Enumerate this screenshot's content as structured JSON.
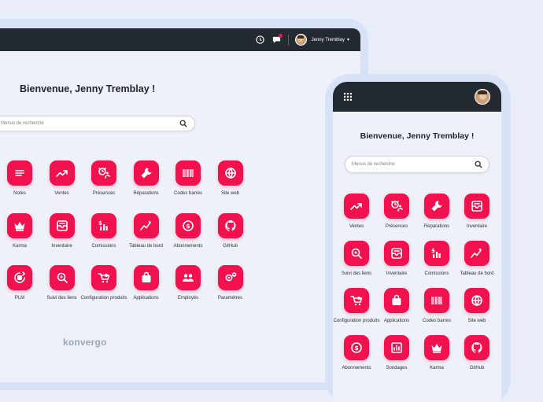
{
  "app": {
    "brand": "konvergo"
  },
  "desktop": {
    "user_name": "Jenny Tremblay",
    "welcome": "Bienvenue, Jenny Tremblay !",
    "search_placeholder": "Menus de recherche",
    "apps": [
      {
        "label": "Notes",
        "icon": "notes-icon"
      },
      {
        "label": "Ventes",
        "icon": "trend-up-icon"
      },
      {
        "label": "Présences",
        "icon": "attendance-icon"
      },
      {
        "label": "Réparations",
        "icon": "wrench-icon"
      },
      {
        "label": "Codes barres",
        "icon": "barcode-icon"
      },
      {
        "label": "Site web",
        "icon": "globe-icon"
      },
      {
        "label": "Karma",
        "icon": "crown-icon"
      },
      {
        "label": "Inventaire",
        "icon": "inventory-icon"
      },
      {
        "label": "Comissions",
        "icon": "commission-icon"
      },
      {
        "label": "Tableau de bord",
        "icon": "dashboard-icon"
      },
      {
        "label": "Abonnements",
        "icon": "subscription-icon"
      },
      {
        "label": "GitHub",
        "icon": "github-icon"
      },
      {
        "label": "PLM",
        "icon": "plm-icon"
      },
      {
        "label": "Suivi des liens",
        "icon": "link-tracker-icon"
      },
      {
        "label": "Configuration produits",
        "icon": "product-config-icon"
      },
      {
        "label": "Applications",
        "icon": "bag-icon"
      },
      {
        "label": "Employés",
        "icon": "employees-icon"
      },
      {
        "label": "Paramètres",
        "icon": "gear-icon"
      }
    ]
  },
  "mobile": {
    "welcome": "Bienvenue, Jenny Tremblay !",
    "search_placeholder": "Menus de recherche",
    "apps": [
      {
        "label": "Ventes",
        "icon": "trend-up-icon"
      },
      {
        "label": "Présences",
        "icon": "attendance-icon"
      },
      {
        "label": "Réparations",
        "icon": "wrench-icon"
      },
      {
        "label": "Inventaire",
        "icon": "inventory-icon"
      },
      {
        "label": "Suivi des liens",
        "icon": "link-tracker-icon"
      },
      {
        "label": "Inventaire",
        "icon": "inventory-icon"
      },
      {
        "label": "Comissions",
        "icon": "commission-icon"
      },
      {
        "label": "Tableau de bord",
        "icon": "dashboard-icon"
      },
      {
        "label": "Configuration produits",
        "icon": "product-config-icon"
      },
      {
        "label": "Applications",
        "icon": "bag-icon"
      },
      {
        "label": "Codes barres",
        "icon": "barcode-icon"
      },
      {
        "label": "Site web",
        "icon": "globe-icon"
      },
      {
        "label": "Abonnements",
        "icon": "subscription-icon"
      },
      {
        "label": "Sondages",
        "icon": "survey-icon"
      },
      {
        "label": "Karma",
        "icon": "crown-icon"
      },
      {
        "label": "GitHub",
        "icon": "github-icon"
      }
    ]
  },
  "colors": {
    "accent": "#f0114e",
    "topbar": "#242a32",
    "background": "#e8edf8"
  }
}
